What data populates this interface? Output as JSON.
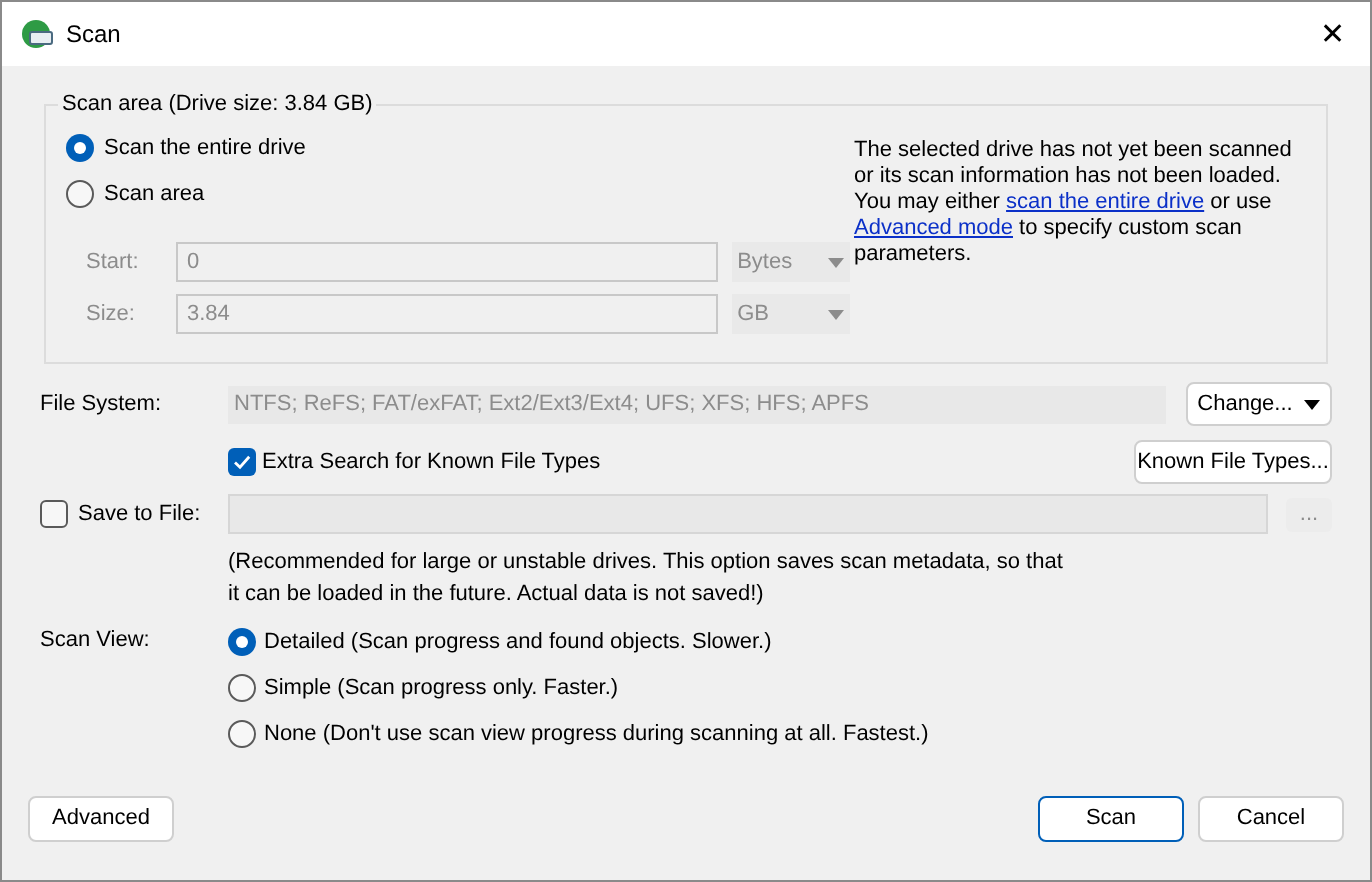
{
  "window": {
    "title": "Scan",
    "close": "✕"
  },
  "scan_area": {
    "legend": "Scan area (Drive size: 3.84 GB)",
    "options": [
      {
        "label": "Scan the entire drive",
        "selected": true
      },
      {
        "label": "Scan area",
        "selected": false
      }
    ],
    "fields": [
      {
        "label": "Start:",
        "value": "0",
        "unit": "Bytes",
        "disabled": true
      },
      {
        "label": "Size:",
        "value": "3.84",
        "unit": "GB",
        "disabled": true
      }
    ],
    "info": [
      {
        "kind": "text",
        "text": "The selected drive has not yet been scanned or its scan information has not been loaded. You may either "
      },
      {
        "kind": "link",
        "text": "scan the entire drive"
      },
      {
        "kind": "text",
        "text": " or use "
      },
      {
        "kind": "link",
        "text": "Advanced mode"
      },
      {
        "kind": "text",
        "text": " to specify custom scan parameters."
      }
    ]
  },
  "file_system": {
    "label": "File System:",
    "value": "NTFS; ReFS; FAT/exFAT; Ext2/Ext3/Ext4; UFS; XFS; HFS; APFS",
    "button": "Change..."
  },
  "extra_search": {
    "label": "Extra Search for Known File Types",
    "checked": true,
    "button": "Known File Types..."
  },
  "save_to_file": {
    "label": "Save to File:",
    "checked": false,
    "browse": "...",
    "note": "(Recommended for large or unstable drives. This option saves scan metadata, so that it can be loaded in the future. Actual data is not saved!)"
  },
  "scan_view": {
    "label": "Scan View:",
    "options": [
      {
        "label": "Detailed (Scan progress and found objects. Slower.)",
        "selected": true
      },
      {
        "label": "Simple (Scan progress only. Faster.)",
        "selected": false
      },
      {
        "label": "None (Don't use scan view progress during scanning at all. Fastest.)",
        "selected": false
      }
    ]
  },
  "buttons": [
    {
      "label": "Advanced",
      "kind": "secondary"
    },
    {
      "label": "Scan",
      "kind": "default"
    },
    {
      "label": "Cancel",
      "kind": "secondary"
    }
  ]
}
